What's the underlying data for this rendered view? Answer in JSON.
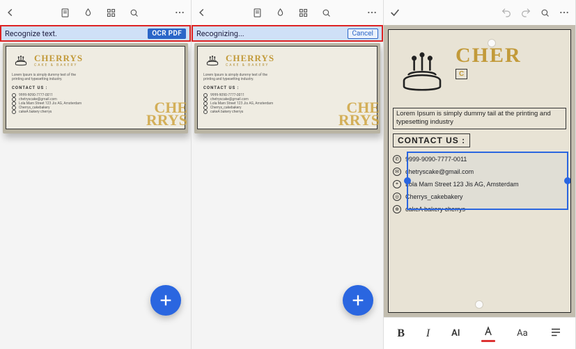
{
  "panel1": {
    "status_text": "Recognize text.",
    "action_label": "OCR PDF"
  },
  "panel2": {
    "status_text": "Recognizing...",
    "action_label": "Cancel"
  },
  "card": {
    "brand": "CHERRYS",
    "brand_sub": "CAKE & BAKERY",
    "lorem": "Lorem Ipsum is simply dummy text of the printing and typesetting industry.",
    "contact_label": "CONTACT US :",
    "contacts": [
      "9999-9090-7777-0011",
      "chetryscake@gmail.com",
      "Lola Mam Street 123 Jis AG, Amsterdam",
      "Cherrys_cakebakery",
      "cakeA bakery cherrys"
    ],
    "watermark_line1": "CHE",
    "watermark_line2": "RRYS"
  },
  "zoom": {
    "brand": "CHER",
    "brand_box": "C",
    "lorem": "Lorem Ipsum is simply dummy tail at the printing and typesetting industry",
    "contact_label": "CONTACT US :",
    "contacts": [
      "9999-9090-7777-0011",
      "chetryscake@gmail.com",
      "Lola Mam Street 123 Jis AG, Amsterdam",
      "Cherrys_cakebakery",
      "cakeA bakery cherrys"
    ]
  },
  "toolbar": {
    "ai_label": "AI",
    "aa_label": "Aa"
  }
}
